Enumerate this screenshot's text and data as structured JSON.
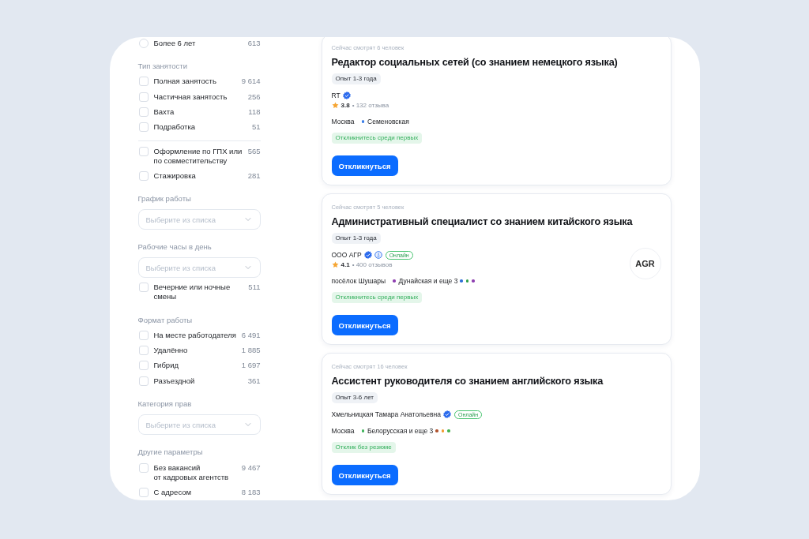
{
  "sidebar": {
    "sections": [
      {
        "groups": [
          {
            "items": [
              {
                "kind": "radio",
                "label": "Более 6 лет",
                "count": "613",
                "selected": false
              }
            ]
          }
        ]
      },
      {
        "title": "Тип занятости",
        "groups": [
          {
            "items": [
              {
                "kind": "checkbox",
                "label": "Полная занятость",
                "count": "9 614",
                "checked": false
              },
              {
                "kind": "checkbox",
                "label": "Частичная занятость",
                "count": "256",
                "checked": false
              },
              {
                "kind": "checkbox",
                "label": "Вахта",
                "count": "118",
                "checked": false
              },
              {
                "kind": "checkbox",
                "label": "Подработка",
                "count": "51",
                "checked": false
              }
            ]
          },
          {
            "items": [
              {
                "kind": "checkbox",
                "label": "Оформление по ГПХ или\nпо совместительству",
                "count": "565",
                "checked": false
              },
              {
                "kind": "checkbox",
                "label": "Стажировка",
                "count": "281",
                "checked": false
              }
            ]
          }
        ]
      },
      {
        "title": "График работы",
        "select": {
          "placeholder": "Выберите из списка"
        }
      },
      {
        "title": "Рабочие часы в день",
        "select": {
          "placeholder": "Выберите из списка"
        },
        "groups": [
          {
            "items": [
              {
                "kind": "checkbox",
                "label": "Вечерние или ночные\nсмены",
                "count": "511",
                "checked": false
              }
            ]
          }
        ]
      },
      {
        "title": "Формат работы",
        "groups": [
          {
            "items": [
              {
                "kind": "checkbox",
                "label": "На месте работодателя",
                "count": "6 491",
                "checked": false
              },
              {
                "kind": "checkbox",
                "label": "Удалённо",
                "count": "1 885",
                "checked": false
              },
              {
                "kind": "checkbox",
                "label": "Гибрид",
                "count": "1 697",
                "checked": false
              },
              {
                "kind": "checkbox",
                "label": "Разъездной",
                "count": "361",
                "checked": false
              }
            ]
          }
        ]
      },
      {
        "title": "Категория прав",
        "select": {
          "placeholder": "Выберите из списка"
        }
      },
      {
        "title": "Другие параметры",
        "groups": [
          {
            "items": [
              {
                "kind": "checkbox",
                "label": "Без вакансий\nот кадровых агентств",
                "count": "9 467",
                "checked": false
              },
              {
                "kind": "checkbox",
                "label": "С адресом",
                "count": "8 183",
                "checked": false
              }
            ]
          }
        ]
      }
    ]
  },
  "vacancies": [
    {
      "viewers": "Сейчас смотрят 6 человек",
      "title": "Редактор социальных сетей (со знанием немецкого языка)",
      "experience": "Опыт 1-3 года",
      "employer": {
        "name": "RT",
        "badges": [
          {
            "kind": "verified"
          }
        ]
      },
      "rating": {
        "score": "3.8",
        "reviews": "• 132 отзыва"
      },
      "location": {
        "city": "Москва",
        "metro": {
          "text": "Семеновская",
          "color": "#3b7ee8"
        }
      },
      "highlight": "Откликнитесь среди первых",
      "button": "Откликнуться"
    },
    {
      "viewers": "Сейчас смотрят 5 человек",
      "title": "Административный специалист со знанием китайского языка",
      "experience": "Опыт 1-3 года",
      "employer": {
        "name": "ООО АГР",
        "badges": [
          {
            "kind": "verified"
          },
          {
            "kind": "round"
          }
        ],
        "status": "Онлайн"
      },
      "rating": {
        "score": "4.1",
        "reviews": "• 400 отзывов"
      },
      "logo": "AGR",
      "location": {
        "city": "посёлок Шушары",
        "metro": {
          "text": "Дунайская и еще 3",
          "color": "#8e3fb0",
          "more_lines": [
            {
              "color": "#2f6fd6"
            },
            {
              "color": "#2e9e48"
            },
            {
              "color": "#8e3fb0"
            }
          ]
        }
      },
      "highlight": "Откликнитесь среди первых",
      "button": "Откликнуться"
    },
    {
      "viewers": "Сейчас смотрят 16 человек",
      "title": "Ассистент руководителя со знанием английского языка",
      "experience": "Опыт 3-6 лет",
      "employer": {
        "name": "Хмельницкая Тамара Анатольевна",
        "badges": [
          {
            "kind": "verified"
          }
        ],
        "status": "Онлайн"
      },
      "location": {
        "city": "Москва",
        "metro": {
          "text": "Белорусская и еще 3",
          "color": "#3fb35a",
          "more_lines": [
            {
              "color": "#b0532e"
            },
            {
              "color": "#f29a2e"
            },
            {
              "color": "#46b34f"
            }
          ]
        }
      },
      "highlight": "Отклик без резюме",
      "button": "Откликнуться"
    }
  ]
}
